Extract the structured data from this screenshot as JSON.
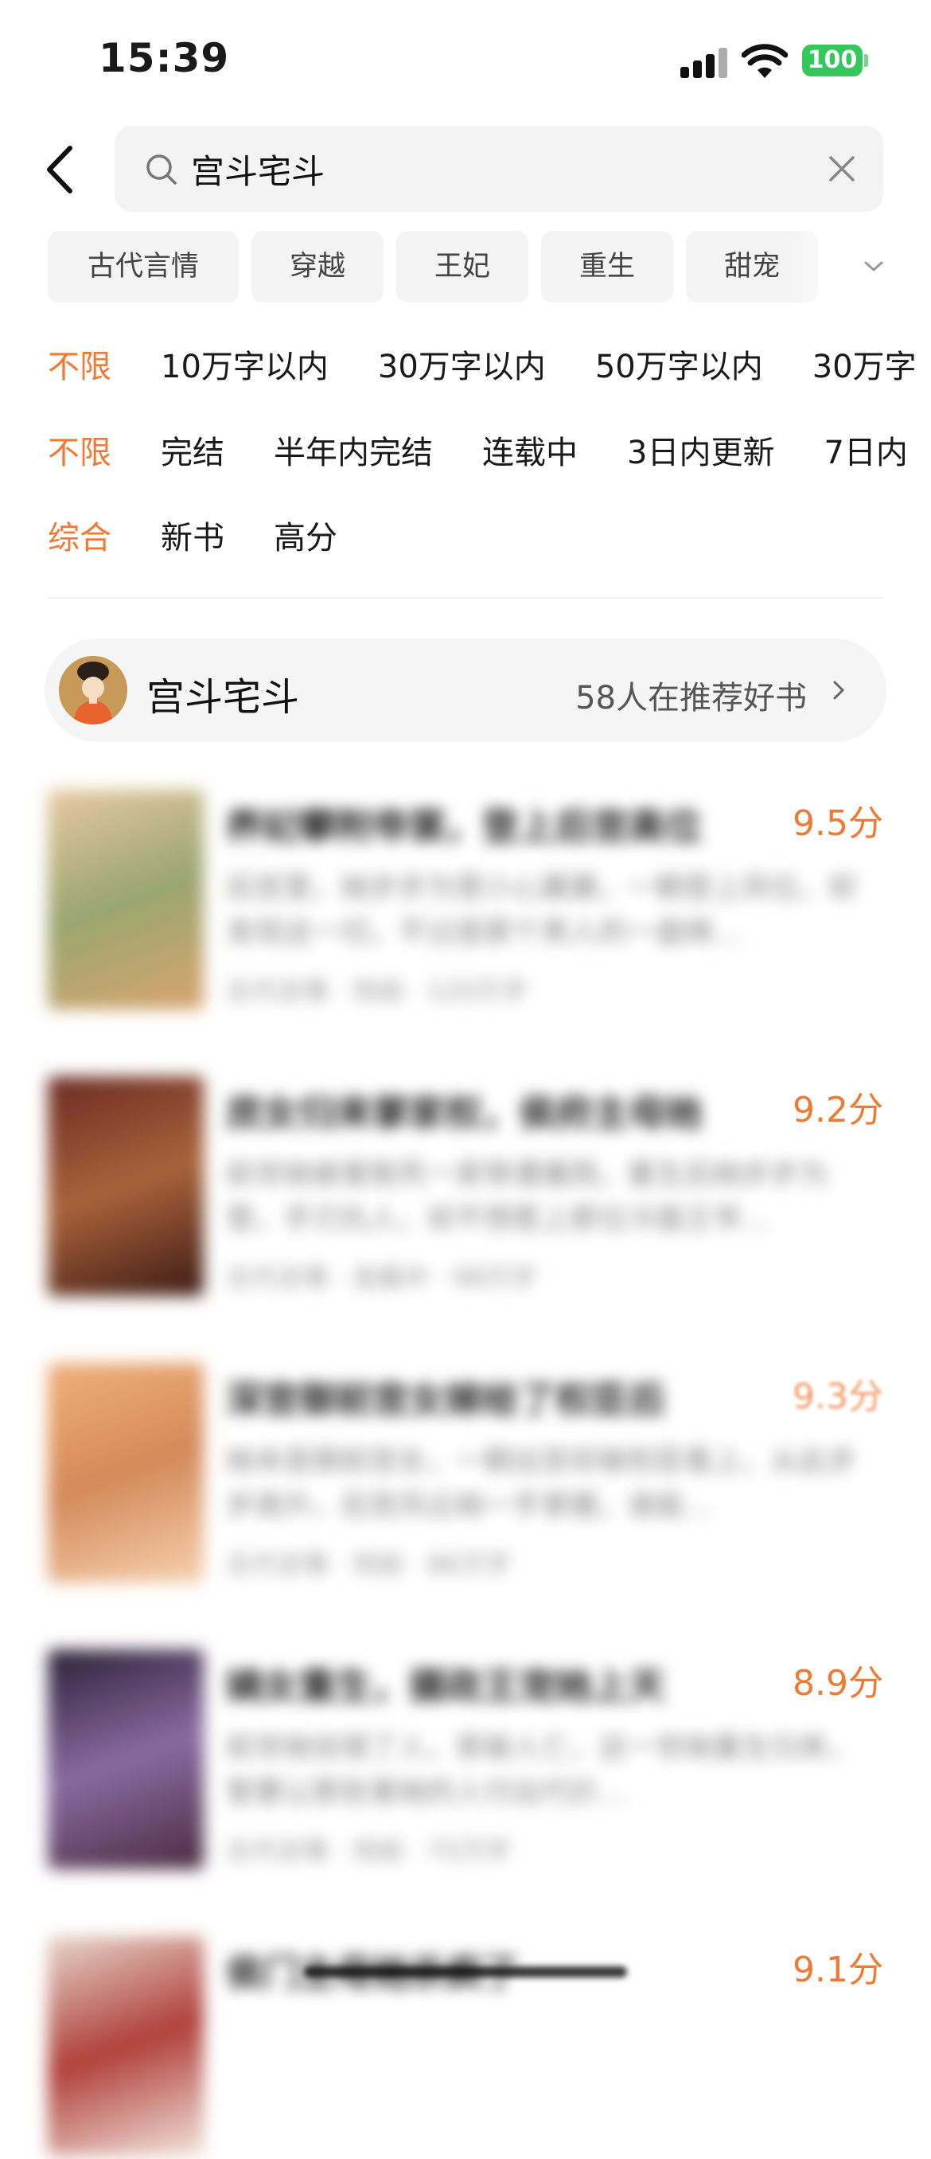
{
  "status_bar": {
    "time": "15:39",
    "battery": "100"
  },
  "search": {
    "query": "宫斗宅斗"
  },
  "tags": [
    "古代言情",
    "穿越",
    "王妃",
    "重生",
    "甜宠"
  ],
  "filters": {
    "word_count": [
      "不限",
      "10万字以内",
      "30万字以内",
      "50万字以内",
      "30万字"
    ],
    "status": [
      "不限",
      "完结",
      "半年内完结",
      "连载中",
      "3日内更新",
      "7日内"
    ],
    "sort": [
      "综合",
      "新书",
      "高分"
    ]
  },
  "banner": {
    "title": "宫斗宅斗",
    "count": "58人在推荐好书"
  },
  "books": [
    {
      "title": "养妃攀附帝裳，登上后宫高位",
      "desc": "后宫里，她步步为营小心翼翼，一朝登上凤位，却发现这一切，不过是那个男人的一盘棋…",
      "meta": "古代言情 · 完结 · 120万字",
      "score": "9.5分",
      "cover": [
        "#e8c9a0",
        "#9aa66f",
        "#d8a46f"
      ]
    },
    {
      "title": "庶女归来掌家权，侯府主母她",
      "desc": "前世她被害致死一家惨遭屠戮，重生后她步步为营，手刃仇人，却不想惹上那位冷面王爷…",
      "meta": "古代言情 · 连载中 · 98万字",
      "score": "9.2分",
      "cover": [
        "#6b2b22",
        "#a8623a",
        "#3c1a14"
      ]
    },
    {
      "title": "深宫御前宫女嫁给了权臣后",
      "desc": "她本是御前宫女，一朝出宫却被权臣看上，从此步步高升，后宫风云她一手掌握，谁能…",
      "meta": "古代言情 · 完结 · 86万字",
      "score": "9.3分",
      "cover": [
        "#f0b07a",
        "#d48a5a",
        "#f6d2b0"
      ]
    },
    {
      "title": "嫡女重生，摄政王宠她上天",
      "desc": "前世她信错了人，家破人亡，这一世她重生归来，誓要让那些害她的人付出代价…",
      "meta": "古代言情 · 完结 · 75万字",
      "score": "8.9分",
      "cover": [
        "#2a2036",
        "#8a6aa0",
        "#4a2a3e"
      ]
    },
    {
      "title": "侯门主母她杀疯了",
      "desc": "",
      "meta": "",
      "score": "9.1分",
      "cover": [
        "#e8d6cc",
        "#b0403a",
        "#f2e4dc"
      ]
    }
  ]
}
